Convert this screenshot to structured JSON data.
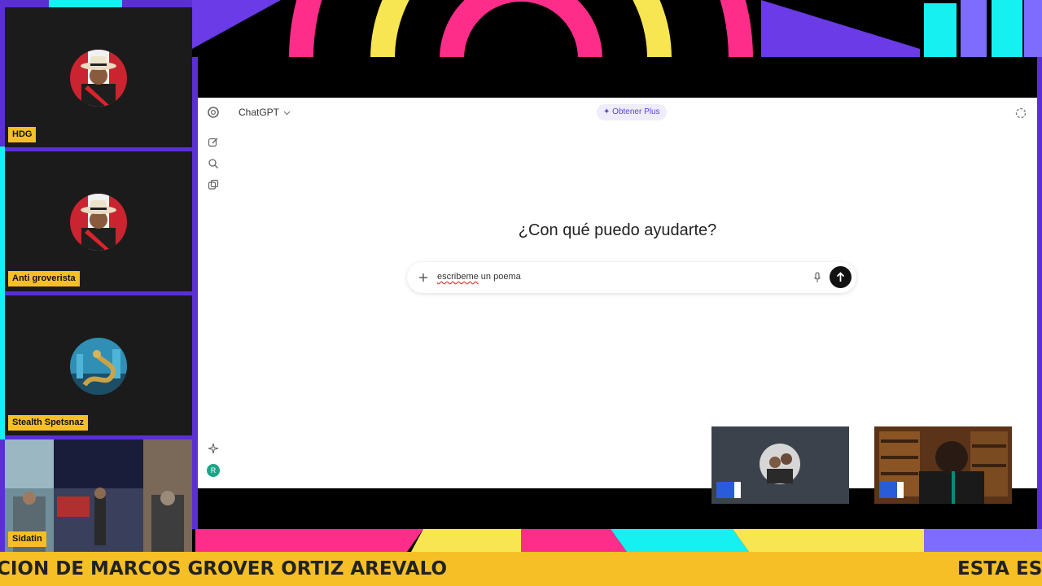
{
  "colors": {
    "background_purple": "#5b2fd6",
    "accent_pink": "#ff2d8a",
    "accent_yellow": "#f7e652",
    "accent_cyan": "#16f0f0",
    "tag_yellow": "#f6bf26",
    "plus_purple": "#5a45d6"
  },
  "participants": [
    {
      "name": "HDG",
      "avatar": "hat-portrait-avatar"
    },
    {
      "name": "Anti groverista",
      "avatar": "hat-portrait-avatar"
    },
    {
      "name": "Stealth Spetsnaz",
      "avatar": "snake-avatar"
    },
    {
      "name": "Sidatin",
      "avatar": "video-collage"
    }
  ],
  "shared_screen": {
    "app": {
      "model_label": "ChatGPT",
      "model_chevron": "chevron-down-icon",
      "get_plus_label": "Obtener Plus",
      "heading": "¿Con qué puedo ayudarte?",
      "composer": {
        "misspelled_word": "escribeme",
        "rest_text": " un poema"
      },
      "sidebar_icons": [
        "openai-logo-icon",
        "new-chat-icon",
        "search-icon",
        "library-icon",
        "sparkle-icon",
        "account-avatar-icon"
      ],
      "account_initial": "R"
    }
  },
  "ticker": {
    "segment_left": "CION DE MARCOS GROVER ORTIZ AREVALO",
    "segment_right": "ESTA ES"
  }
}
